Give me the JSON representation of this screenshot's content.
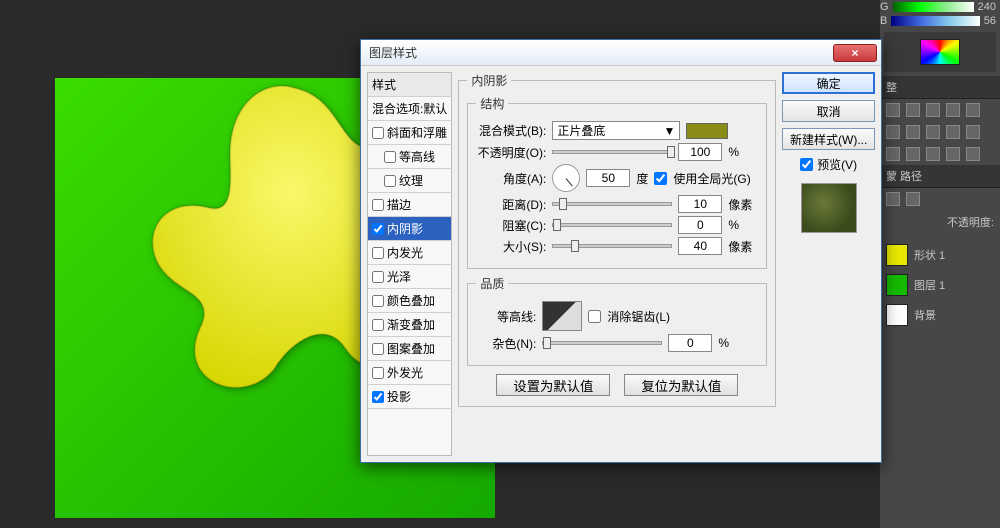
{
  "right_panel": {
    "g_label": "G",
    "g_value": "240",
    "b_label": "B",
    "b_value": "56",
    "adjust_tab": "整",
    "mask_tab": "蒙 路径",
    "opacity_label": "不透明度:",
    "layers": [
      {
        "name": "形状 1"
      },
      {
        "name": "图层 1"
      },
      {
        "name": "背景"
      }
    ]
  },
  "dialog": {
    "title": "图层样式",
    "close_x": "×",
    "style_list": {
      "header": "样式",
      "blend_defaults": "混合选项:默认",
      "items": [
        {
          "label": "斜面和浮雕",
          "checked": false
        },
        {
          "label": "等高线",
          "checked": false,
          "indent": true
        },
        {
          "label": "纹理",
          "checked": false,
          "indent": true
        },
        {
          "label": "描边",
          "checked": false
        },
        {
          "label": "内阴影",
          "checked": true,
          "selected": true
        },
        {
          "label": "内发光",
          "checked": false
        },
        {
          "label": "光泽",
          "checked": false
        },
        {
          "label": "颜色叠加",
          "checked": false
        },
        {
          "label": "渐变叠加",
          "checked": false
        },
        {
          "label": "图案叠加",
          "checked": false
        },
        {
          "label": "外发光",
          "checked": false
        },
        {
          "label": "投影",
          "checked": true
        }
      ]
    },
    "settings": {
      "section_title": "内阴影",
      "structure_title": "结构",
      "blend_mode_label": "混合模式(B):",
      "blend_mode_value": "正片叠底",
      "swatch_color": "#898d17",
      "opacity_label": "不透明度(O):",
      "opacity_value": "100",
      "opacity_unit": "%",
      "angle_label": "角度(A):",
      "angle_value": "50",
      "angle_deg": "度",
      "global_light": "使用全局光(G)",
      "global_light_checked": true,
      "distance_label": "距离(D):",
      "distance_value": "10",
      "px": "像素",
      "choke_label": "阻塞(C):",
      "choke_value": "0",
      "choke_unit": "%",
      "size_label": "大小(S):",
      "size_value": "40",
      "quality_title": "品质",
      "contour_label": "等高线:",
      "antialias": "消除锯齿(L)",
      "noise_label": "杂色(N):",
      "noise_value": "0",
      "noise_unit": "%",
      "set_default": "设置为默认值",
      "reset_default": "复位为默认值"
    },
    "right": {
      "ok": "确定",
      "cancel": "取消",
      "new_style": "新建样式(W)...",
      "preview": "预览(V)"
    }
  }
}
